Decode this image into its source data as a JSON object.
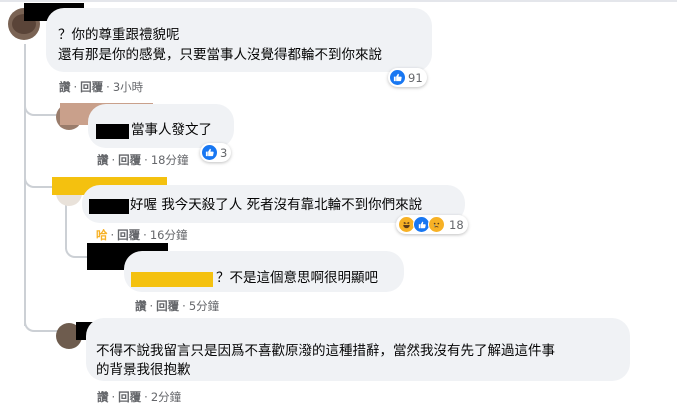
{
  "comments": [
    {
      "lines": [
        "？你的尊重跟禮貌呢",
        "還有那是你的感覺，只要當事人沒覺得都輪不到你來說"
      ],
      "reactions": "91",
      "actions": {
        "a": "讚",
        "b": "回覆",
        "time": "3小時"
      }
    },
    {
      "lines": [
        "當事人發文了"
      ],
      "reactions": "3",
      "actions": {
        "a": "讚",
        "b": "回覆",
        "time": "18分鐘"
      }
    },
    {
      "lines": [
        "好喔 我今天殺了人 死者沒有靠北輪不到你們來說"
      ],
      "reactions": "18",
      "actions": {
        "a": "哈",
        "b": "回覆",
        "time": "16分鐘"
      },
      "action_color": "#f7b125"
    },
    {
      "lines": [
        "？不是這個意思啊很明顯吧"
      ],
      "actions": {
        "a": "讚",
        "b": "回覆",
        "time": "5分鐘"
      }
    },
    {
      "lines": [
        "不得不說我留言只是因爲不喜歡原潑的這種措辭，當然我沒有先了解過這件事",
        "的背景我很抱歉"
      ],
      "actions": {
        "a": "讚",
        "b": "回覆",
        "time": "2分鐘"
      }
    }
  ],
  "icons": {
    "like": "like-icon",
    "haha": "haha-emoji-icon",
    "care": "care-emoji-icon",
    "sad": "sad-emoji-icon"
  },
  "colors": {
    "bubble": "#f0f2f5",
    "meta": "#65676b",
    "like_blue": "#1877f2",
    "highlight": "#f4c10f"
  }
}
